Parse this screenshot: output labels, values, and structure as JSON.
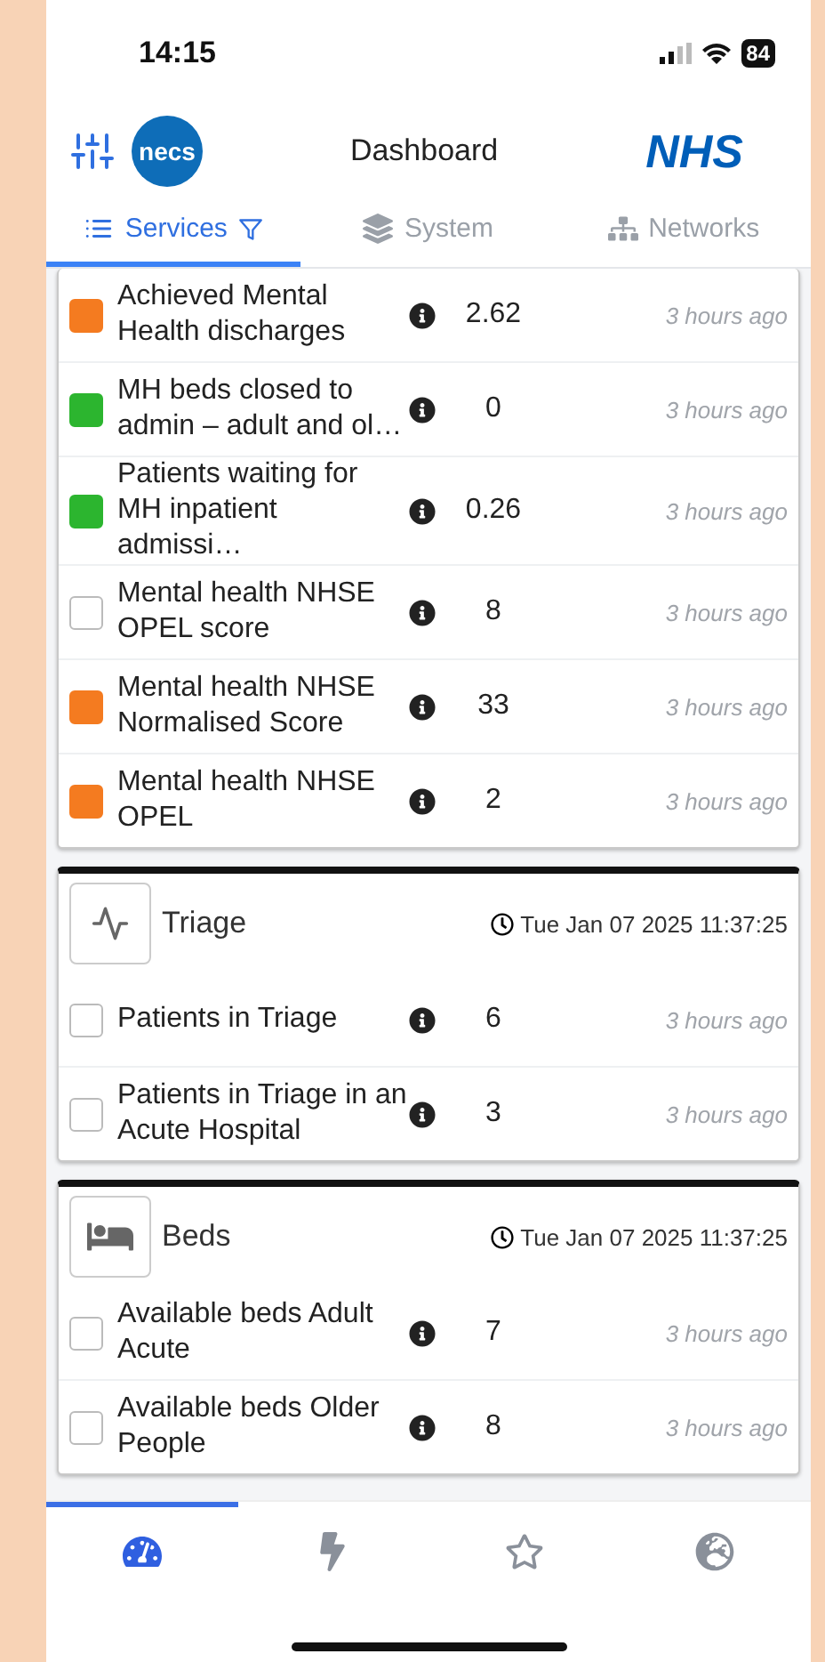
{
  "status_bar": {
    "time": "14:15",
    "battery": "84"
  },
  "header": {
    "title": "Dashboard",
    "logo_text": "necs",
    "brand": "NHS"
  },
  "tabs": [
    {
      "label": "Services",
      "selected": true
    },
    {
      "label": "System",
      "selected": false
    },
    {
      "label": "Networks",
      "selected": false
    }
  ],
  "cards": [
    {
      "kind": "list",
      "rows": [
        {
          "name": "Achieved Mental Health discharges",
          "value": "2.62",
          "updated": "3 hours ago",
          "color": "#f47b20"
        },
        {
          "name": "MH beds closed to admin – adult and ol…",
          "value": "0",
          "updated": "3 hours ago",
          "color": "#2cb52f"
        },
        {
          "name": "Patients waiting for MH inpatient admissi…",
          "value": "0.26",
          "updated": "3 hours ago",
          "color": "#2cb52f"
        },
        {
          "name": "Mental health NHSE OPEL score",
          "value": "8",
          "updated": "3 hours ago",
          "color": "#ffffff"
        },
        {
          "name": "Mental health NHSE Normalised Score",
          "value": "33",
          "updated": "3 hours ago",
          "color": "#f47b20"
        },
        {
          "name": "Mental health NHSE OPEL",
          "value": "2",
          "updated": "3 hours ago",
          "color": "#f47b20"
        }
      ]
    },
    {
      "kind": "triage",
      "title": "Triage",
      "timestamp": "Tue Jan 07 2025 11:37:25",
      "rows": [
        {
          "name": "Patients in Triage",
          "value": "6",
          "updated": "3 hours ago",
          "color": "#ffffff"
        },
        {
          "name": "Patients in Triage in an Acute Hospital",
          "value": "3",
          "updated": "3 hours ago",
          "color": "#ffffff"
        }
      ]
    },
    {
      "kind": "beds",
      "title": "Beds",
      "timestamp": "Tue Jan 07 2025 11:37:25",
      "rows": [
        {
          "name": "Available beds Adult Acute",
          "value": "7",
          "updated": "3 hours ago",
          "color": "#ffffff"
        },
        {
          "name": "Available beds Older People",
          "value": "8",
          "updated": "3 hours ago",
          "color": "#ffffff"
        }
      ]
    }
  ],
  "bottom_nav": [
    {
      "kind": "dashboard",
      "selected": true
    },
    {
      "kind": "bolt",
      "selected": false
    },
    {
      "kind": "star",
      "selected": false
    },
    {
      "kind": "globe",
      "selected": false
    }
  ]
}
